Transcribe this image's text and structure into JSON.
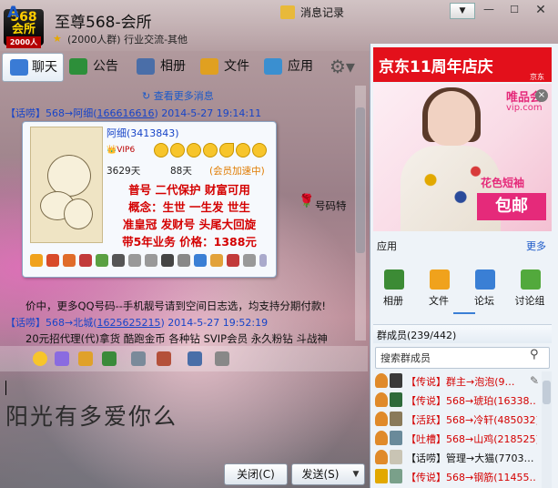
{
  "window": {
    "logo_top": "568",
    "logo_mid": "会所",
    "logo_bottom": "2000人",
    "title": "至尊568-会所",
    "subtitle": "(2000人群) 行业交流-其他"
  },
  "tabs": [
    {
      "label": "聊天"
    },
    {
      "label": "公告"
    },
    {
      "label": "相册"
    },
    {
      "label": "文件"
    },
    {
      "label": "应用"
    }
  ],
  "chat": {
    "more_messages": "查看更多消息",
    "messages": [
      {
        "tag": "【话唠】",
        "from_to": "568→阿细(",
        "qq": "166616616",
        "time": ") 2014-5-27 19:14:11"
      },
      {
        "tag": "【话唠】",
        "from_to": "568→北城(",
        "qq": "1625625215",
        "time": ") 2014-5-27 19:52:19"
      }
    ],
    "line_a": "价中，更多QQ号码--手机靓号请到空间日志选，均支持分期付款!",
    "line_b": "20元招代理(代)拿货 酷跑金币 各种钻 SVIP会员 永久粉钻 斗战神",
    "card": {
      "name": "阿细(3413843)",
      "vip": "VIP6",
      "days_active": "3629天",
      "days_accel": "88天",
      "accel_label": "(会员加速中)",
      "ad_lines": [
        "普号  二代保护  财富可用",
        "概念：生世  一生发  世生",
        "准皇冠  发财号  头尾大回旋",
        "带5年业务  价格：1388元"
      ]
    },
    "right_nick": "号码特"
  },
  "input": {
    "text": "阳光有多爱你么",
    "record_label": "消息记录",
    "close_label": "关闭(C)",
    "send_label": "发送(S)"
  },
  "ads": {
    "jd": "京东11周年店庆",
    "jd_small": "京东",
    "vip_logo": "唯品会",
    "vip_url": "vip.com",
    "vip_category": "花色短袖",
    "vip_mail": "包邮"
  },
  "apps": {
    "title": "应用",
    "more": "更多",
    "items": [
      {
        "label": "相册"
      },
      {
        "label": "文件"
      },
      {
        "label": "论坛"
      },
      {
        "label": "讨论组"
      }
    ]
  },
  "members": {
    "count": "群成员(239/442)",
    "search_placeholder": "搜索群成员",
    "rows": [
      {
        "name": "【传说】群主→泡泡(9…",
        "red": true
      },
      {
        "name": "【传说】568→琥珀(16338…",
        "red": true
      },
      {
        "name": "【活跃】568→冷轩(485032)",
        "red": true
      },
      {
        "name": "【吐槽】568→山鸡(218525)",
        "red": true
      },
      {
        "name": "【话唠】管理→大猫(7703…",
        "red": false
      },
      {
        "name": "【传说】568→钢筋(11455…",
        "red": true
      }
    ]
  }
}
